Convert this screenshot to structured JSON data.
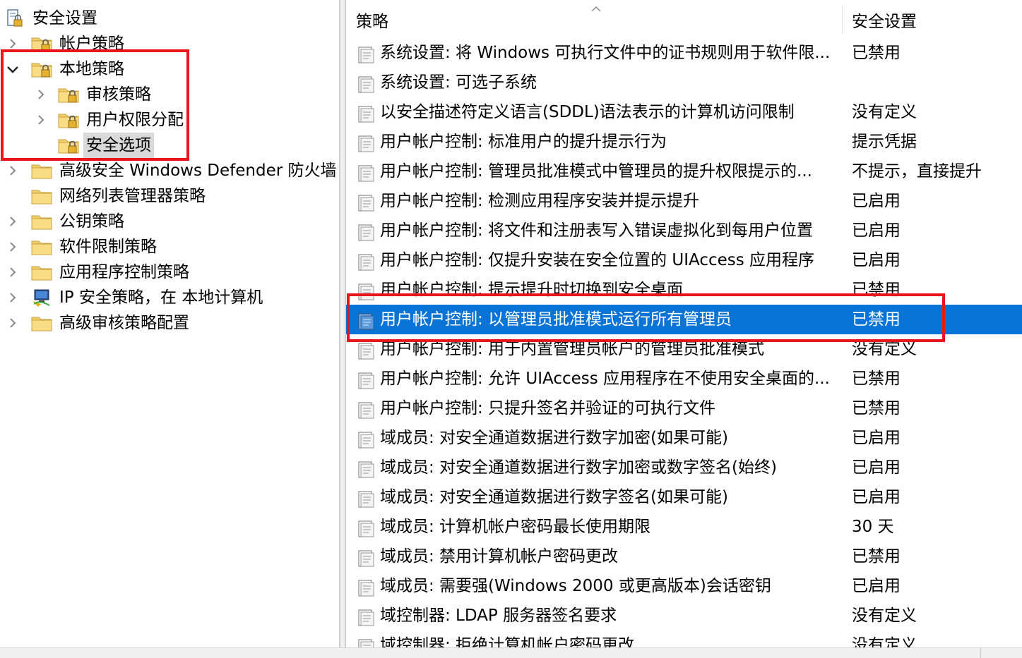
{
  "tree": {
    "root": {
      "label": "安全设置",
      "icon": "security-settings-icon"
    },
    "items": [
      {
        "label": "帐户策略",
        "icon": "lock-folder-icon",
        "expander": "collapsed"
      },
      {
        "label": "本地策略",
        "icon": "lock-folder-icon",
        "expander": "expanded"
      },
      {
        "label": "审核策略",
        "icon": "lock-folder-icon",
        "expander": "collapsed"
      },
      {
        "label": "用户权限分配",
        "icon": "lock-folder-icon",
        "expander": "collapsed"
      },
      {
        "label": "安全选项",
        "icon": "lock-folder-icon",
        "expander": "none",
        "selected": true
      },
      {
        "label": "高级安全 Windows Defender 防火墙",
        "icon": "folder-icon",
        "expander": "collapsed"
      },
      {
        "label": "网络列表管理器策略",
        "icon": "folder-icon",
        "expander": "none"
      },
      {
        "label": "公钥策略",
        "icon": "folder-icon",
        "expander": "collapsed"
      },
      {
        "label": "软件限制策略",
        "icon": "folder-icon",
        "expander": "collapsed"
      },
      {
        "label": "应用程序控制策略",
        "icon": "folder-icon",
        "expander": "collapsed"
      },
      {
        "label": "IP 安全策略，在 本地计算机",
        "icon": "ip-security-icon",
        "expander": "collapsed"
      },
      {
        "label": "高级审核策略配置",
        "icon": "folder-icon",
        "expander": "collapsed"
      }
    ]
  },
  "list": {
    "columns": {
      "policy": "策略",
      "setting": "安全设置"
    },
    "rows": [
      {
        "policy": "系统设置: 将 Windows 可执行文件中的证书规则用于软件限...",
        "setting": "已禁用"
      },
      {
        "policy": "系统设置: 可选子系统",
        "setting": ""
      },
      {
        "policy": "以安全描述符定义语言(SDDL)语法表示的计算机访问限制",
        "setting": "没有定义"
      },
      {
        "policy": "用户帐户控制: 标准用户的提升提示行为",
        "setting": "提示凭据"
      },
      {
        "policy": "用户帐户控制: 管理员批准模式中管理员的提升权限提示的...",
        "setting": "不提示，直接提升"
      },
      {
        "policy": "用户帐户控制: 检测应用程序安装并提示提升",
        "setting": "已启用"
      },
      {
        "policy": "用户帐户控制: 将文件和注册表写入错误虚拟化到每用户位置",
        "setting": "已启用"
      },
      {
        "policy": "用户帐户控制: 仅提升安装在安全位置的 UIAccess 应用程序",
        "setting": "已启用"
      },
      {
        "policy": "用户帐户控制: 提示提升时切换到安全桌面",
        "setting": "已禁用"
      },
      {
        "policy": "用户帐户控制: 以管理员批准模式运行所有管理员",
        "setting": "已禁用",
        "selected": true
      },
      {
        "policy": "用户帐户控制: 用于内置管理员帐户的管理员批准模式",
        "setting": "没有定义"
      },
      {
        "policy": "用户帐户控制: 允许 UIAccess 应用程序在不使用安全桌面的...",
        "setting": "已禁用"
      },
      {
        "policy": "用户帐户控制: 只提升签名并验证的可执行文件",
        "setting": "已禁用"
      },
      {
        "policy": "域成员: 对安全通道数据进行数字加密(如果可能)",
        "setting": "已启用"
      },
      {
        "policy": "域成员: 对安全通道数据进行数字加密或数字签名(始终)",
        "setting": "已启用"
      },
      {
        "policy": "域成员: 对安全通道数据进行数字签名(如果可能)",
        "setting": "已启用"
      },
      {
        "policy": "域成员: 计算机帐户密码最长使用期限",
        "setting": "30 天"
      },
      {
        "policy": "域成员: 禁用计算机帐户密码更改",
        "setting": "已禁用"
      },
      {
        "policy": "域成员: 需要强(Windows 2000 或更高版本)会话密钥",
        "setting": "已启用"
      },
      {
        "policy": "域控制器: LDAP 服务器签名要求",
        "setting": "没有定义"
      },
      {
        "policy": "域控制器: 拒绝计算机帐户密码更改",
        "setting": "没有定义"
      }
    ]
  },
  "colors": {
    "selection": "#0a74d6",
    "tree_selection": "#d9d9d9",
    "annotation_red": "#e8161c",
    "folder": "#f3cf6c"
  }
}
